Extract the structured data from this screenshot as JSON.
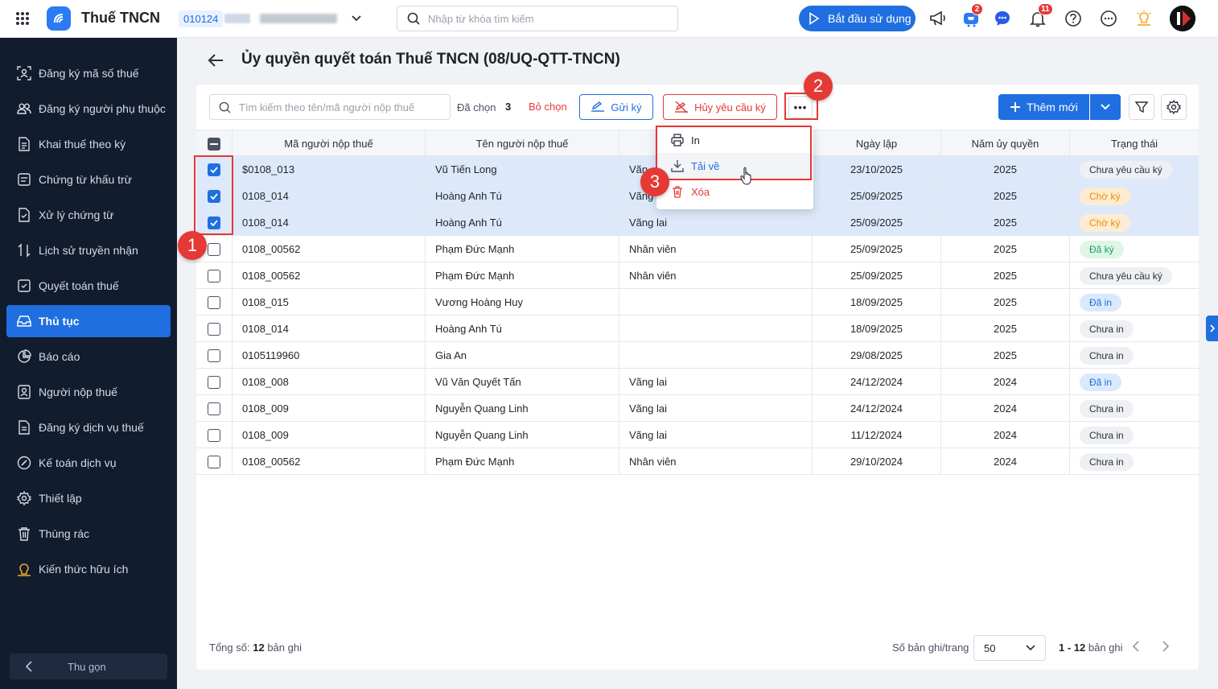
{
  "topbar": {
    "app_title": "Thuế TNCN",
    "tax_code": "010124",
    "search_placeholder": "Nhập từ khóa tìm kiếm",
    "start_button": "Bắt đầu sử dụng",
    "cart_badge": "2",
    "notification_badge": "11"
  },
  "sidebar": {
    "items": [
      {
        "label": "Đăng ký mã số thuế",
        "icon": "user-scan-icon"
      },
      {
        "label": "Đăng ký người phụ thuộc",
        "icon": "people-icon"
      },
      {
        "label": "Khai thuế theo kỳ",
        "icon": "document-icon"
      },
      {
        "label": "Chứng từ khấu trừ",
        "icon": "receipt-icon"
      },
      {
        "label": "Xử lý chứng từ",
        "icon": "file-check-icon"
      },
      {
        "label": "Lịch sử truyền nhận",
        "icon": "transfer-icon"
      },
      {
        "label": "Quyết toán thuế",
        "icon": "settlement-icon"
      },
      {
        "label": "Thủ tục",
        "icon": "inbox-icon"
      },
      {
        "label": "Báo cáo",
        "icon": "pie-chart-icon"
      },
      {
        "label": "Người nộp thuế",
        "icon": "user-card-icon"
      },
      {
        "label": "Đăng ký dịch vụ thuế",
        "icon": "register-icon"
      },
      {
        "label": "Kế toán dịch vụ",
        "icon": "accounting-icon"
      },
      {
        "label": "Thiết lập",
        "icon": "gear-icon"
      },
      {
        "label": "Thùng rác",
        "icon": "trash-icon"
      },
      {
        "label": "Kiến thức hữu ích",
        "icon": "knowledge-icon"
      }
    ],
    "active_index": 7,
    "collapse_label": "Thu gọn"
  },
  "page": {
    "title": "Ủy quyền quyết toán Thuế TNCN (08/UQ-QTT-TNCN)"
  },
  "toolbar": {
    "search_placeholder": "Tìm kiếm theo tên/mã người nộp thuế",
    "selected_label": "Đã chọn",
    "selected_count": "3",
    "deselect_label": "Bỏ chọn",
    "send_sign_label": "Gửi ký",
    "cancel_request_label": "Hủy yêu cầu ký",
    "more_label": "•••",
    "add_new_label": "Thêm mới"
  },
  "dropdown": {
    "items": [
      "In",
      "Tải về",
      "Xóa"
    ]
  },
  "table": {
    "columns": [
      "Mã người nộp thuế",
      "Tên người nộp thuế",
      "",
      "Ngày lập",
      "Năm ủy quyền",
      "Trạng thái"
    ],
    "rows": [
      {
        "code": "$0108_013",
        "name": "Vũ Tiến Long",
        "type": "Vãn",
        "date": "23/10/2025",
        "year": "2025",
        "status": "Chưa yêu cầu ký",
        "status_kind": "gray",
        "checked": true
      },
      {
        "code": "0108_014",
        "name": "Hoàng Anh Tú",
        "type": "Vãng",
        "date": "25/09/2025",
        "year": "2025",
        "status": "Chờ ký",
        "status_kind": "orange",
        "checked": true
      },
      {
        "code": "0108_014",
        "name": "Hoàng Anh Tú",
        "type": "Vãng lai",
        "date": "25/09/2025",
        "year": "2025",
        "status": "Chờ ký",
        "status_kind": "orange",
        "checked": true
      },
      {
        "code": "0108_00562",
        "name": "Phạm Đức Mạnh",
        "type": "Nhân viên",
        "date": "25/09/2025",
        "year": "2025",
        "status": "Đã ký",
        "status_kind": "green",
        "checked": false
      },
      {
        "code": "0108_00562",
        "name": "Phạm Đức Mạnh",
        "type": "Nhân viên",
        "date": "25/09/2025",
        "year": "2025",
        "status": "Chưa yêu cầu ký",
        "status_kind": "gray",
        "checked": false
      },
      {
        "code": "0108_015",
        "name": "Vương Hoàng Huy",
        "type": "",
        "date": "18/09/2025",
        "year": "2025",
        "status": "Đã in",
        "status_kind": "blue",
        "checked": false
      },
      {
        "code": "0108_014",
        "name": "Hoàng Anh Tú",
        "type": "",
        "date": "18/09/2025",
        "year": "2025",
        "status": "Chưa in",
        "status_kind": "gray",
        "checked": false
      },
      {
        "code": "0105119960",
        "name": "Gia An",
        "type": "",
        "date": "29/08/2025",
        "year": "2025",
        "status": "Chưa in",
        "status_kind": "gray",
        "checked": false
      },
      {
        "code": "0108_008",
        "name": "Vũ Văn Quyết Tấn",
        "type": "Vãng lai",
        "date": "24/12/2024",
        "year": "2024",
        "status": "Đã in",
        "status_kind": "blue",
        "checked": false
      },
      {
        "code": "0108_009",
        "name": "Nguyễn Quang Linh",
        "type": "Vãng lai",
        "date": "24/12/2024",
        "year": "2024",
        "status": "Chưa in",
        "status_kind": "gray",
        "checked": false
      },
      {
        "code": "0108_009",
        "name": "Nguyễn Quang Linh",
        "type": "Vãng lai",
        "date": "11/12/2024",
        "year": "2024",
        "status": "Chưa in",
        "status_kind": "gray",
        "checked": false
      },
      {
        "code": "0108_00562",
        "name": "Phạm Đức Mạnh",
        "type": "Nhân viên",
        "date": "29/10/2024",
        "year": "2024",
        "status": "Chưa in",
        "status_kind": "gray",
        "checked": false
      }
    ]
  },
  "footer": {
    "total_prefix": "Tổng số:",
    "total_count": "12",
    "total_suffix": "bản ghi",
    "per_page_label": "Số bản ghi/trang",
    "per_page_value": "50",
    "range": "1 - 12",
    "range_suffix": "bản ghi"
  },
  "annotations": [
    "1",
    "2",
    "3"
  ],
  "colors": {
    "primary": "#1f6fe0",
    "danger": "#e53935",
    "sidebar_bg": "#111c2e",
    "selected_row": "#dde9fb"
  }
}
